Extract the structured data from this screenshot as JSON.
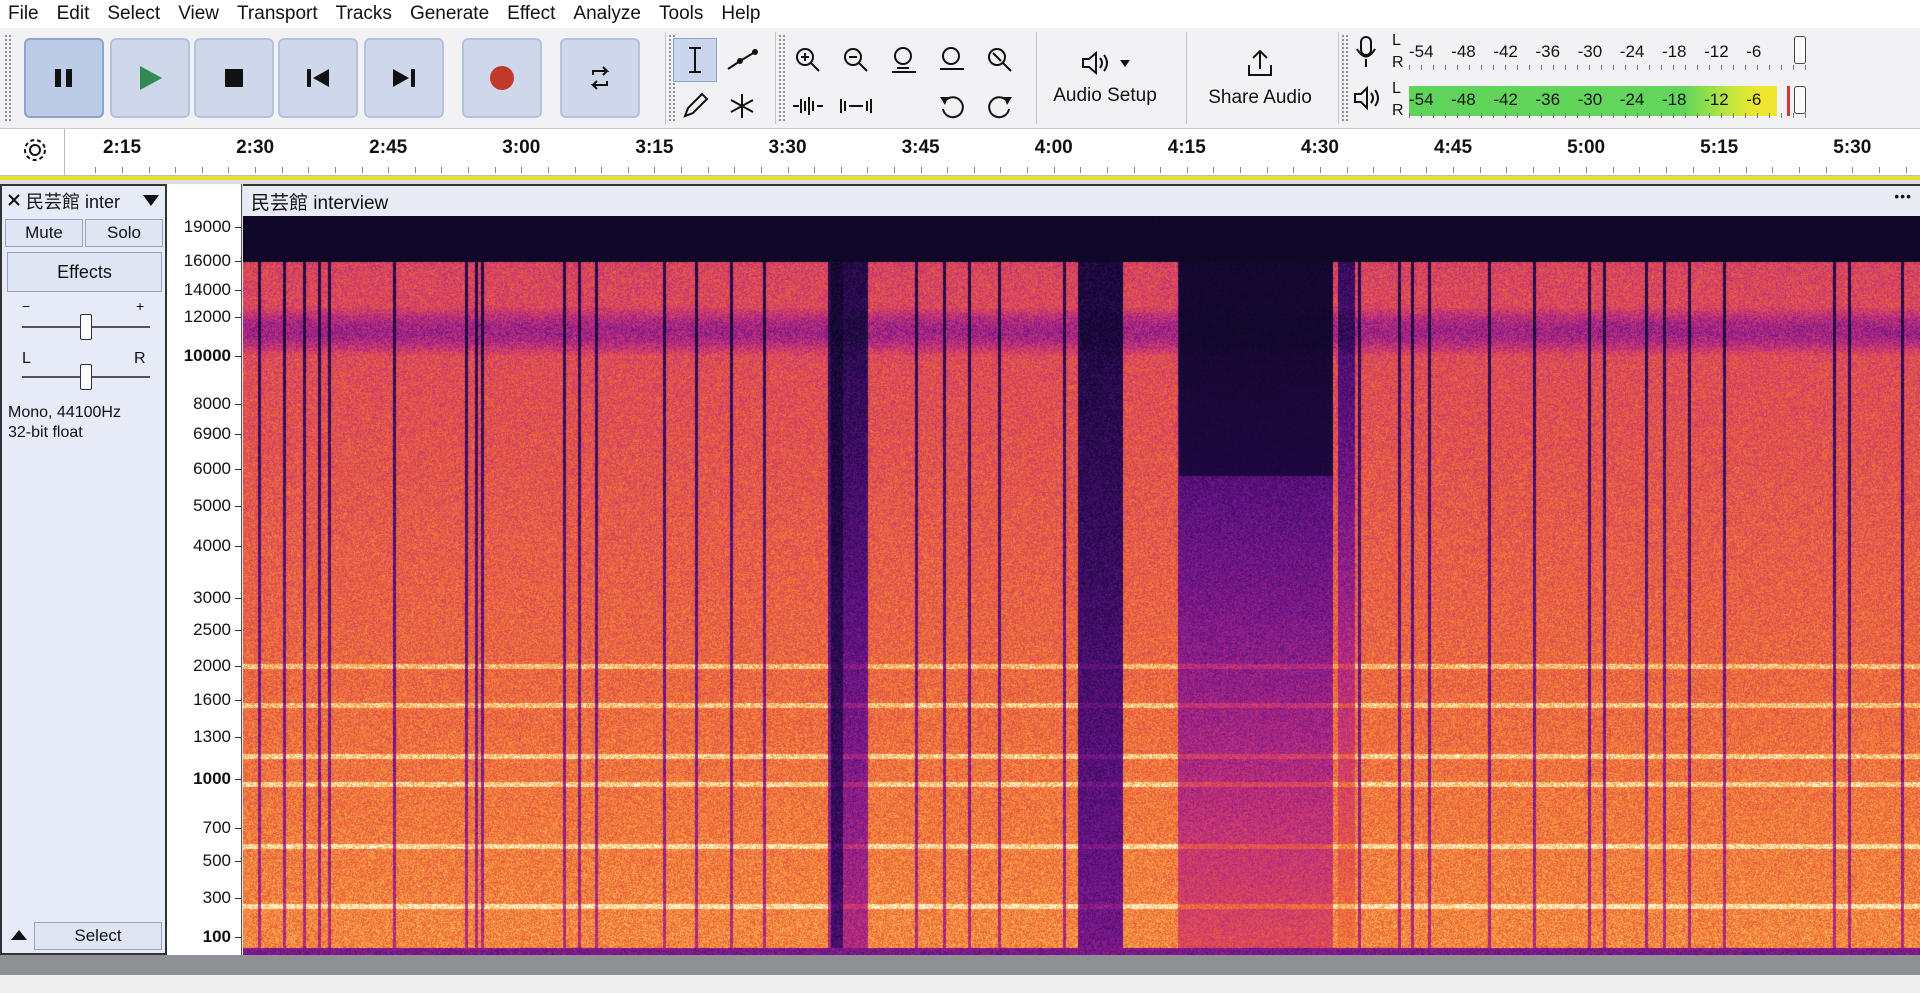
{
  "menus": [
    "File",
    "Edit",
    "Select",
    "View",
    "Transport",
    "Tracks",
    "Generate",
    "Effect",
    "Analyze",
    "Tools",
    "Help"
  ],
  "toolbar": {
    "audio_setup_label": "Audio Setup",
    "share_audio_label": "Share Audio"
  },
  "meters": {
    "record_scale": [
      "-54",
      "-48",
      "-42",
      "-36",
      "-30",
      "-24",
      "-18",
      "-12",
      "-6"
    ],
    "playback_scale": [
      "-54",
      "-48",
      "-42",
      "-36",
      "-30",
      "-24",
      "-18",
      "-12",
      "-6"
    ],
    "channel_left": "L",
    "channel_right": "R",
    "playback_level_fraction": 0.92
  },
  "timeline": {
    "labels": [
      "2:15",
      "2:30",
      "2:45",
      "3:00",
      "3:15",
      "3:30",
      "3:45",
      "4:00",
      "4:15",
      "4:30",
      "4:45",
      "5:00",
      "5:15",
      "5:30"
    ]
  },
  "track": {
    "name": "民芸館 inter",
    "mute_label": "Mute",
    "solo_label": "Solo",
    "effects_label": "Effects",
    "gain_minus": "−",
    "gain_plus": "+",
    "pan_left": "L",
    "pan_right": "R",
    "format_line1": "Mono, 44100Hz",
    "format_line2": "32-bit float",
    "select_label": "Select",
    "clip_title": "民芸館 interview",
    "clip_menu": "•••"
  },
  "frequency_axis": [
    {
      "label": "19000",
      "bold": false
    },
    {
      "label": "16000",
      "bold": false
    },
    {
      "label": "14000",
      "bold": false
    },
    {
      "label": "12000",
      "bold": false
    },
    {
      "label": "10000",
      "bold": true
    },
    {
      "label": "8000",
      "bold": false
    },
    {
      "label": "6900",
      "bold": false
    },
    {
      "label": "6000",
      "bold": false
    },
    {
      "label": "5000",
      "bold": false
    },
    {
      "label": "4000",
      "bold": false
    },
    {
      "label": "3000",
      "bold": false
    },
    {
      "label": "2500",
      "bold": false
    },
    {
      "label": "2000",
      "bold": false
    },
    {
      "label": "1600",
      "bold": false
    },
    {
      "label": "1300",
      "bold": false
    },
    {
      "label": "1000",
      "bold": true
    },
    {
      "label": "700",
      "bold": false
    },
    {
      "label": "500",
      "bold": false
    },
    {
      "label": "300",
      "bold": false
    },
    {
      "label": "100",
      "bold": true
    }
  ]
}
